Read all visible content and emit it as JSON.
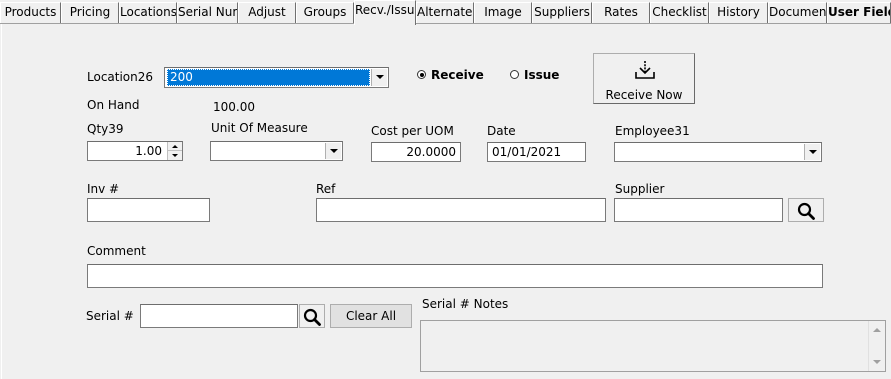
{
  "tabs": [
    {
      "label": "Products"
    },
    {
      "label": "Pricing"
    },
    {
      "label": "Locations"
    },
    {
      "label": "Serial Num"
    },
    {
      "label": "Adjust"
    },
    {
      "label": "Groups"
    },
    {
      "label": "Recv./Issue"
    },
    {
      "label": "Alternates"
    },
    {
      "label": "Image"
    },
    {
      "label": "Suppliers"
    },
    {
      "label": "Rates"
    },
    {
      "label": "Checklist"
    },
    {
      "label": "History"
    },
    {
      "label": "Document"
    },
    {
      "label": "User Fields"
    }
  ],
  "active_tab": "Recv./Issue",
  "location": {
    "label": "Location26",
    "value": "200"
  },
  "mode": {
    "receive_label": "Receive",
    "issue_label": "Issue",
    "selected": "Receive"
  },
  "receive_now": {
    "label": "Receive Now",
    "icon": "download-icon"
  },
  "on_hand": {
    "label": "On Hand",
    "value": "100.00"
  },
  "qty": {
    "label": "Qty39",
    "value": "1.00"
  },
  "uom": {
    "label": "Unit Of Measure",
    "value": ""
  },
  "cost": {
    "label": "Cost per UOM",
    "value": "20.0000"
  },
  "date": {
    "label": "Date",
    "value": "01/01/2021"
  },
  "employee": {
    "label": "Employee31",
    "value": ""
  },
  "inv": {
    "label": "Inv #",
    "value": ""
  },
  "ref": {
    "label": "Ref",
    "value": ""
  },
  "supplier": {
    "label": "Supplier",
    "value": "",
    "icon": "search-icon"
  },
  "comment": {
    "label": "Comment",
    "value": ""
  },
  "serial": {
    "label": "Serial #",
    "value": "",
    "icon": "search-icon",
    "clear_label": "Clear All"
  },
  "serial_notes": {
    "label": "Serial # Notes",
    "value": ""
  },
  "colors": {
    "selection": "#0078d7",
    "background": "#f0f0f0"
  }
}
